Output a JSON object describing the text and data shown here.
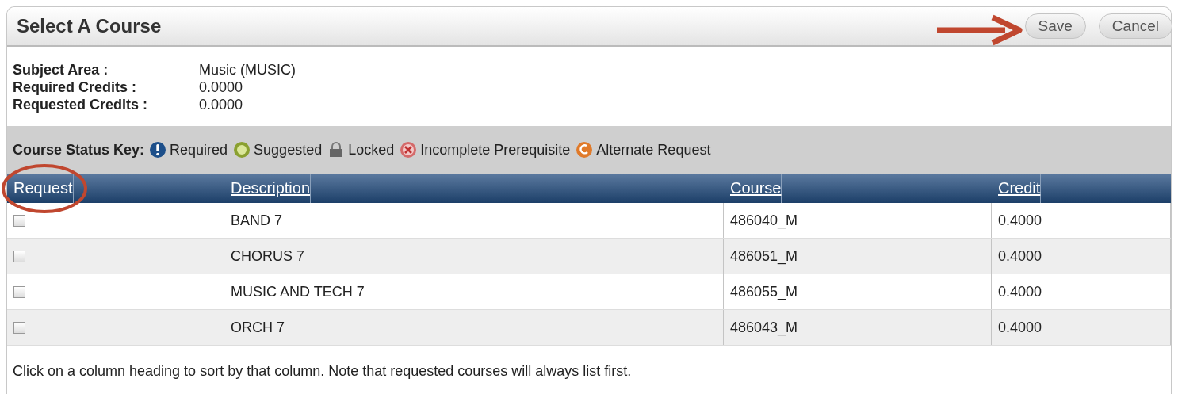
{
  "panel": {
    "title": "Select A Course",
    "buttons": [
      "Save",
      "Cancel"
    ]
  },
  "info": [
    {
      "label": "Subject Area :",
      "value": "Music (MUSIC)"
    },
    {
      "label": "Required Credits :",
      "value": "0.0000"
    },
    {
      "label": "Requested Credits :",
      "value": "0.0000"
    }
  ],
  "status_key": {
    "label": "Course Status Key:",
    "items": [
      {
        "kind": "required",
        "label": "Required"
      },
      {
        "kind": "suggested",
        "label": "Suggested"
      },
      {
        "kind": "locked",
        "label": "Locked"
      },
      {
        "kind": "incomplete",
        "label": "Incomplete Prerequisite"
      },
      {
        "kind": "alternate",
        "label": "Alternate Request"
      }
    ]
  },
  "table": {
    "columns": [
      {
        "label": "Request",
        "sortable": false
      },
      {
        "label": "Description",
        "sortable": true
      },
      {
        "label": "Course",
        "sortable": true
      },
      {
        "label": "Credit",
        "sortable": true
      }
    ],
    "rows": [
      {
        "checked": false,
        "description": "BAND 7",
        "course": "486040_M",
        "credit": "0.4000"
      },
      {
        "checked": false,
        "description": "CHORUS 7",
        "course": "486051_M",
        "credit": "0.4000"
      },
      {
        "checked": false,
        "description": "MUSIC AND TECH 7",
        "course": "486055_M",
        "credit": "0.4000"
      },
      {
        "checked": false,
        "description": "ORCH 7",
        "course": "486043_M",
        "credit": "0.4000"
      }
    ]
  },
  "footer_note": "Click on a column heading to sort by that column. Note that requested courses will always list first."
}
